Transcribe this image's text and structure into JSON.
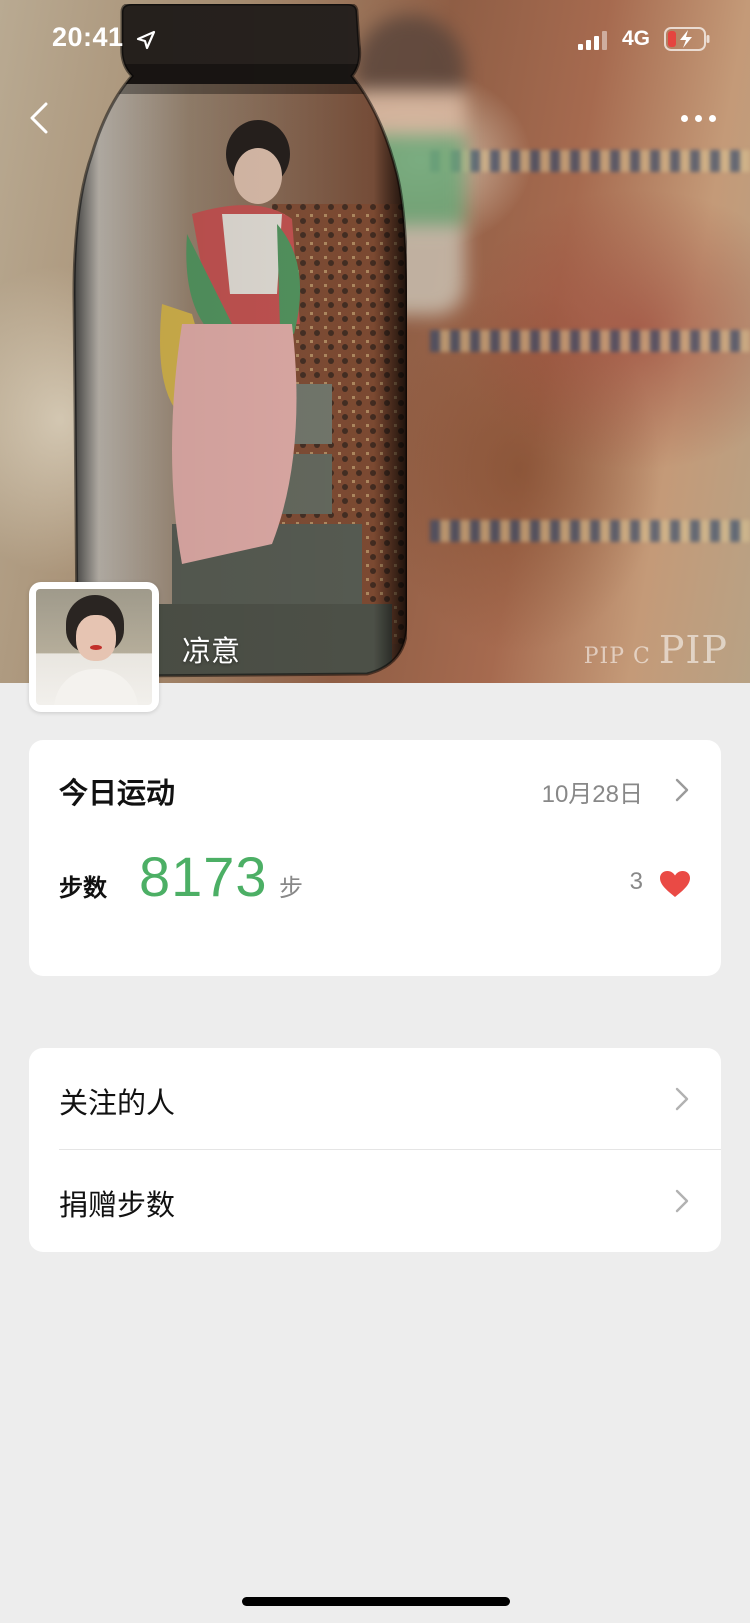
{
  "status_bar": {
    "time": "20:41",
    "network": "4G"
  },
  "profile": {
    "name": "凉意",
    "cover_watermark": "PIP",
    "cover_watermark_small": "PIP C"
  },
  "today_sport": {
    "title": "今日运动",
    "date": "10月28日",
    "steps_label": "步数",
    "steps_value": "8173",
    "steps_unit": "步",
    "likes": "3"
  },
  "menu": {
    "items": [
      {
        "label": "关注的人"
      },
      {
        "label": "捐赠步数"
      }
    ]
  },
  "colors": {
    "accent_green": "#4caf65",
    "heart_red": "#ea4a45",
    "page_bg": "#ededed"
  }
}
